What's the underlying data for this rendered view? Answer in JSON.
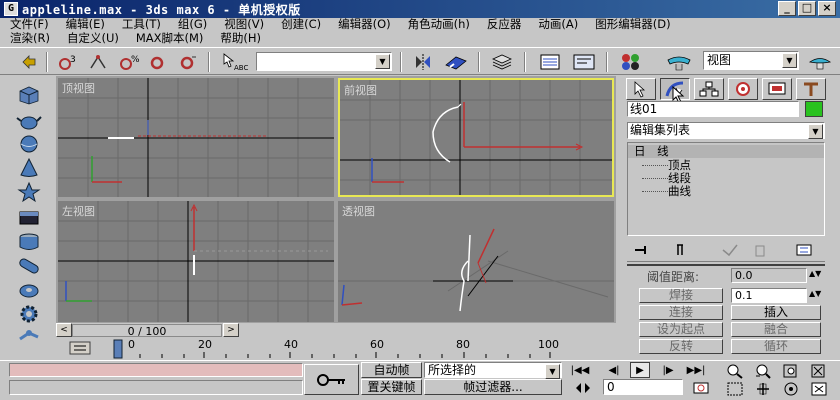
{
  "window": {
    "title": "appleline.max - 3ds max 6 - 单机授权版",
    "app_icon": "3ds-max-icon",
    "buttons": [
      "_",
      "□",
      "×"
    ]
  },
  "menu": {
    "row1": [
      "文件(F)",
      "编辑(E)",
      "工具(T)",
      "组(G)",
      "视图(V)",
      "创建(C)",
      "编辑器(O)",
      "角色动画(h)",
      "反应器",
      "动画(A)",
      "图形编辑器(D)"
    ],
    "row2": [
      "渲染(R)",
      "自定义(U)",
      "MAX脚本(M)",
      "帮助(H)"
    ]
  },
  "toolbar": {
    "named_selection": "",
    "view_dropdown": "视图"
  },
  "viewports": {
    "top": {
      "label": "顶视图"
    },
    "front": {
      "label": "前视图"
    },
    "left": {
      "label": "左视图"
    },
    "perspective": {
      "label": "透视图"
    }
  },
  "time_slider": {
    "prev": "<",
    "counter": "0 / 100",
    "next": ">"
  },
  "trackbar": {
    "ticks": [
      "0",
      "20",
      "40",
      "60",
      "80",
      "100"
    ]
  },
  "command_panel": {
    "object_name": "线01",
    "object_color": "#29c21f",
    "modifier_list": "编辑集列表",
    "stack": {
      "root": "线",
      "root_prefix": "日",
      "items": [
        "顶点",
        "线段",
        "曲线"
      ]
    },
    "rollout": {
      "partial_label": "阈值距离:",
      "partial_value": "0.0",
      "weld_label": "焊接",
      "weld_value": "0.1",
      "connect_label": "连接",
      "insert_label": "插入",
      "first_label": "设为起点",
      "fuse_label": "融合",
      "reverse_label": "反转",
      "cycle_label": "循环"
    }
  },
  "bottom": {
    "auto_key": "自动帧",
    "set_key": "置关键帧",
    "key_filter_dropdown": "所选择的",
    "key_filters": "帧过滤器...",
    "current_frame": "0"
  },
  "colors": {
    "viewport_bg": "#7f7f7f",
    "active_border": "#e8e854",
    "accent": "#0a246a"
  }
}
